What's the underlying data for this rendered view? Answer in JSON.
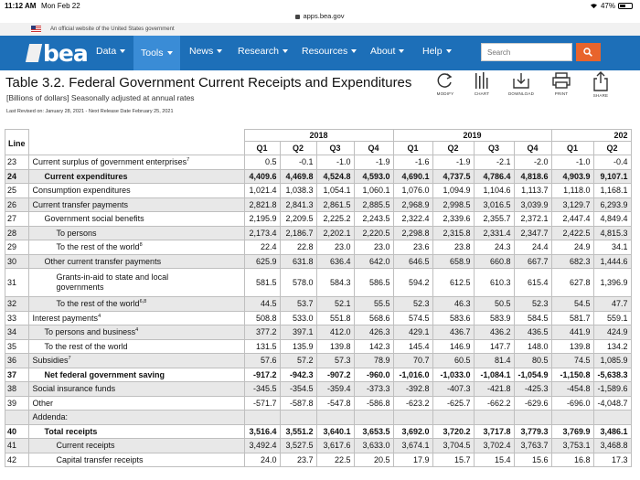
{
  "status": {
    "time": "11:12 AM",
    "date": "Mon Feb 22",
    "battery": "47%"
  },
  "url": "apps.bea.gov",
  "gov_banner": "An official website of the United States government",
  "nav": {
    "logo": "bea",
    "items": [
      "Data",
      "Tools",
      "News",
      "Research",
      "Resources",
      "About",
      "Help"
    ],
    "active": "Tools",
    "search_placeholder": "Search"
  },
  "page": {
    "title": "Table 3.2. Federal Government Current Receipts and Expenditures",
    "subtitle": "[Billions of dollars] Seasonally adjusted at annual rates",
    "revised": "Last Revised on: January 28, 2021 - Next Release Date February 25, 2021"
  },
  "tools": [
    {
      "icon": "refresh-icon",
      "label": "MODIFY"
    },
    {
      "icon": "chart-icon",
      "label": "CHART"
    },
    {
      "icon": "download-icon",
      "label": "DOWNLOAD"
    },
    {
      "icon": "print-icon",
      "label": "PRINT"
    },
    {
      "icon": "share-icon",
      "label": "SHARE"
    }
  ],
  "table": {
    "line_header": "Line",
    "years": [
      "2018",
      "2019",
      "202"
    ],
    "quarters": [
      "Q1",
      "Q2",
      "Q3",
      "Q4",
      "Q1",
      "Q2",
      "Q3",
      "Q4",
      "Q1",
      "Q2"
    ],
    "rows": [
      {
        "line": "23",
        "label": "Current surplus of government enterprises",
        "sup": "7",
        "indent": 0,
        "bold": false,
        "shade": false,
        "values": [
          "0.5",
          "-0.1",
          "-1.0",
          "-1.9",
          "-1.6",
          "-1.9",
          "-2.1",
          "-2.0",
          "-1.0",
          "-0.4"
        ]
      },
      {
        "line": "24",
        "label": "Current expenditures",
        "sup": "",
        "indent": 1,
        "bold": true,
        "shade": true,
        "values": [
          "4,409.6",
          "4,469.8",
          "4,524.8",
          "4,593.0",
          "4,690.1",
          "4,737.5",
          "4,786.4",
          "4,818.6",
          "4,903.9",
          "9,107.1"
        ]
      },
      {
        "line": "25",
        "label": "Consumption expenditures",
        "sup": "",
        "indent": 0,
        "bold": false,
        "shade": false,
        "values": [
          "1,021.4",
          "1,038.3",
          "1,054.1",
          "1,060.1",
          "1,076.0",
          "1,094.9",
          "1,104.6",
          "1,113.7",
          "1,118.0",
          "1,168.1"
        ]
      },
      {
        "line": "26",
        "label": "Current transfer payments",
        "sup": "",
        "indent": 0,
        "bold": false,
        "shade": true,
        "values": [
          "2,821.8",
          "2,841.3",
          "2,861.5",
          "2,885.5",
          "2,968.9",
          "2,998.5",
          "3,016.5",
          "3,039.9",
          "3,129.7",
          "6,293.9"
        ]
      },
      {
        "line": "27",
        "label": "Government social benefits",
        "sup": "",
        "indent": 1,
        "bold": false,
        "shade": false,
        "values": [
          "2,195.9",
          "2,209.5",
          "2,225.2",
          "2,243.5",
          "2,322.4",
          "2,339.6",
          "2,355.7",
          "2,372.1",
          "2,447.4",
          "4,849.4"
        ]
      },
      {
        "line": "28",
        "label": "To persons",
        "sup": "",
        "indent": 2,
        "bold": false,
        "shade": true,
        "values": [
          "2,173.4",
          "2,186.7",
          "2,202.1",
          "2,220.5",
          "2,298.8",
          "2,315.8",
          "2,331.4",
          "2,347.7",
          "2,422.5",
          "4,815.3"
        ]
      },
      {
        "line": "29",
        "label": "To the rest of the world",
        "sup": "8",
        "indent": 2,
        "bold": false,
        "shade": false,
        "values": [
          "22.4",
          "22.8",
          "23.0",
          "23.0",
          "23.6",
          "23.8",
          "24.3",
          "24.4",
          "24.9",
          "34.1"
        ]
      },
      {
        "line": "30",
        "label": "Other current transfer payments",
        "sup": "",
        "indent": 1,
        "bold": false,
        "shade": true,
        "values": [
          "625.9",
          "631.8",
          "636.4",
          "642.0",
          "646.5",
          "658.9",
          "660.8",
          "667.7",
          "682.3",
          "1,444.6"
        ]
      },
      {
        "line": "31",
        "label": "Grants-in-aid to state and local governments",
        "sup": "",
        "indent": 2,
        "bold": false,
        "shade": false,
        "tall": true,
        "values": [
          "581.5",
          "578.0",
          "584.3",
          "586.5",
          "594.2",
          "612.5",
          "610.3",
          "615.4",
          "627.8",
          "1,396.9"
        ]
      },
      {
        "line": "32",
        "label": "To the rest of the world",
        "sup": "6,8",
        "indent": 2,
        "bold": false,
        "shade": true,
        "values": [
          "44.5",
          "53.7",
          "52.1",
          "55.5",
          "52.3",
          "46.3",
          "50.5",
          "52.3",
          "54.5",
          "47.7"
        ]
      },
      {
        "line": "33",
        "label": "Interest payments",
        "sup": "4",
        "indent": 0,
        "bold": false,
        "shade": false,
        "values": [
          "508.8",
          "533.0",
          "551.8",
          "568.6",
          "574.5",
          "583.6",
          "583.9",
          "584.5",
          "581.7",
          "559.1"
        ]
      },
      {
        "line": "34",
        "label": "To persons and business",
        "sup": "4",
        "indent": 1,
        "bold": false,
        "shade": true,
        "values": [
          "377.2",
          "397.1",
          "412.0",
          "426.3",
          "429.1",
          "436.7",
          "436.2",
          "436.5",
          "441.9",
          "424.9"
        ]
      },
      {
        "line": "35",
        "label": "To the rest of the world",
        "sup": "",
        "indent": 1,
        "bold": false,
        "shade": false,
        "values": [
          "131.5",
          "135.9",
          "139.8",
          "142.3",
          "145.4",
          "146.9",
          "147.7",
          "148.0",
          "139.8",
          "134.2"
        ]
      },
      {
        "line": "36",
        "label": "Subsidies",
        "sup": "7",
        "indent": 0,
        "bold": false,
        "shade": true,
        "values": [
          "57.6",
          "57.2",
          "57.3",
          "78.9",
          "70.7",
          "60.5",
          "81.4",
          "80.5",
          "74.5",
          "1,085.9"
        ]
      },
      {
        "line": "37",
        "label": "Net federal government saving",
        "sup": "",
        "indent": 1,
        "bold": true,
        "shade": false,
        "values": [
          "-917.2",
          "-942.3",
          "-907.2",
          "-960.0",
          "-1,016.0",
          "-1,033.0",
          "-1,084.1",
          "-1,054.9",
          "-1,150.8",
          "-5,638.3"
        ]
      },
      {
        "line": "38",
        "label": "Social insurance funds",
        "sup": "",
        "indent": 0,
        "bold": false,
        "shade": true,
        "values": [
          "-345.5",
          "-354.5",
          "-359.4",
          "-373.3",
          "-392.8",
          "-407.3",
          "-421.8",
          "-425.3",
          "-454.8",
          "-1,589.6"
        ]
      },
      {
        "line": "39",
        "label": "Other",
        "sup": "",
        "indent": 0,
        "bold": false,
        "shade": false,
        "values": [
          "-571.7",
          "-587.8",
          "-547.8",
          "-586.8",
          "-623.2",
          "-625.7",
          "-662.2",
          "-629.6",
          "-696.0",
          "-4,048.7"
        ]
      },
      {
        "line": "",
        "label": "Addenda:",
        "sup": "",
        "indent": 0,
        "bold": false,
        "shade": true,
        "values": [
          "",
          "",
          "",
          "",
          "",
          "",
          "",
          "",
          "",
          ""
        ]
      },
      {
        "line": "40",
        "label": "Total receipts",
        "sup": "",
        "indent": 1,
        "bold": true,
        "shade": false,
        "values": [
          "3,516.4",
          "3,551.2",
          "3,640.1",
          "3,653.5",
          "3,692.0",
          "3,720.2",
          "3,717.8",
          "3,779.3",
          "3,769.9",
          "3,486.1"
        ]
      },
      {
        "line": "41",
        "label": "Current receipts",
        "sup": "",
        "indent": 2,
        "bold": false,
        "shade": true,
        "values": [
          "3,492.4",
          "3,527.5",
          "3,617.6",
          "3,633.0",
          "3,674.1",
          "3,704.5",
          "3,702.4",
          "3,763.7",
          "3,753.1",
          "3,468.8"
        ]
      },
      {
        "line": "42",
        "label": "Capital transfer receipts",
        "sup": "",
        "indent": 2,
        "bold": false,
        "shade": false,
        "values": [
          "24.0",
          "23.7",
          "22.5",
          "20.5",
          "17.9",
          "15.7",
          "15.4",
          "15.6",
          "16.8",
          "17.3"
        ]
      }
    ]
  }
}
